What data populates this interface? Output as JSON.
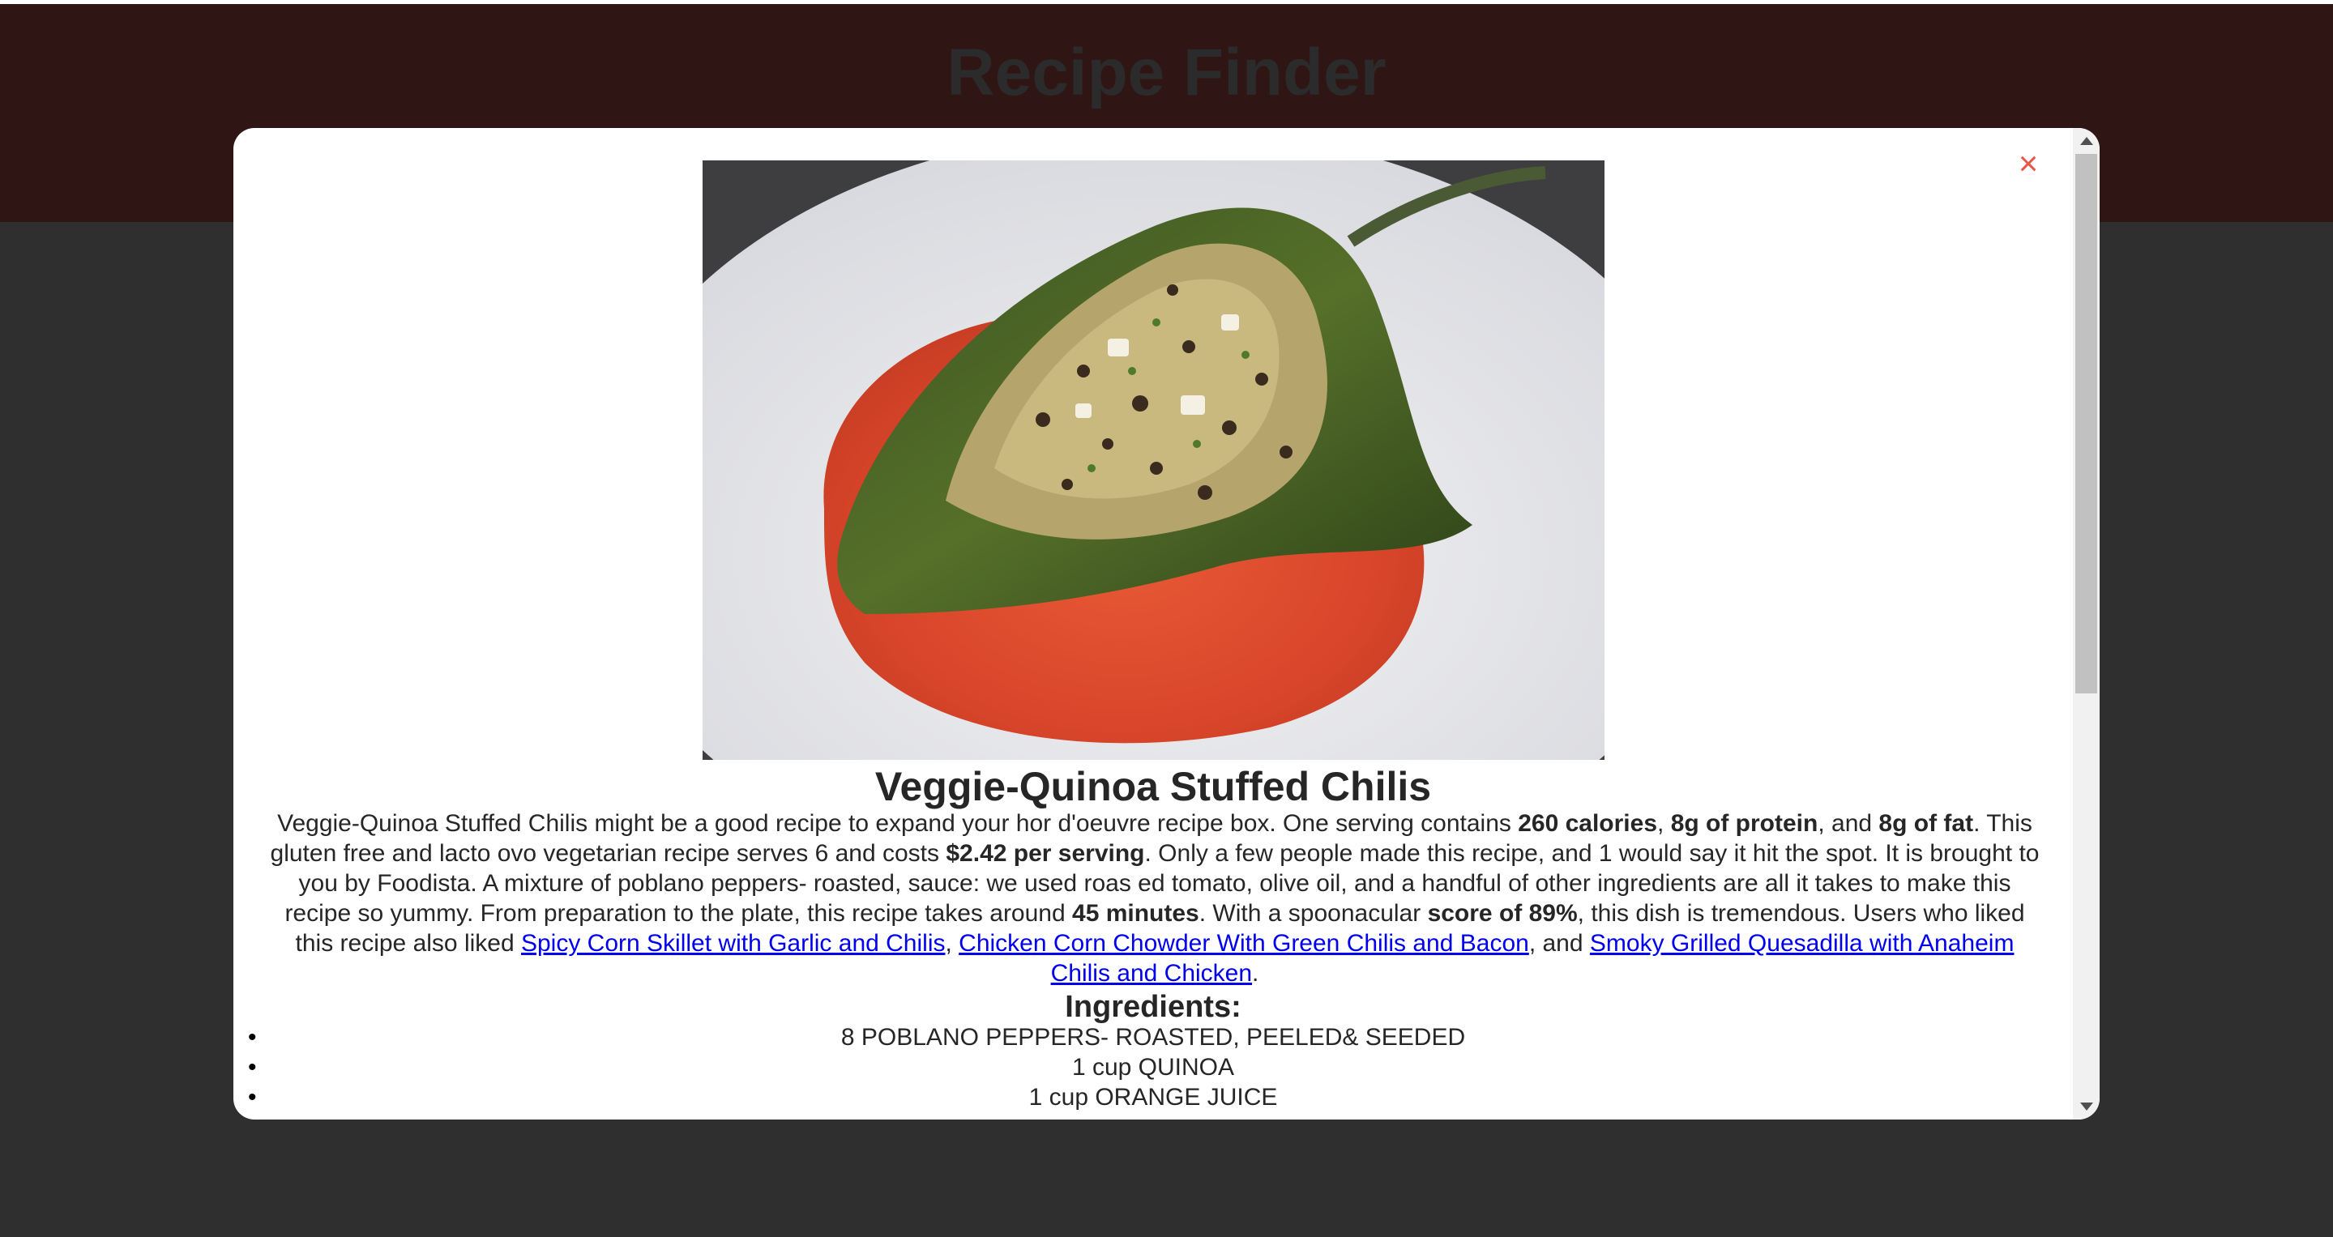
{
  "app": {
    "title": "Recipe Finder"
  },
  "modal": {
    "close_label": "×",
    "recipe_title": "Veggie-Quinoa Stuffed Chilis",
    "summary": {
      "t1": "Veggie-Quinoa Stuffed Chilis might be a good recipe to expand your hor d'oeuvre recipe box. One serving contains ",
      "calories": "260 calories",
      "t2": ", ",
      "protein": "8g of protein",
      "t3": ", and ",
      "fat": "8g of fat",
      "t4": ". This gluten free and lacto ovo vegetarian recipe serves 6 and costs ",
      "cost": "$2.42 per serving",
      "t5": ". Only a few people made this recipe, and 1 would say it hit the spot. It is brought to you by Foodista. A mixture of poblano peppers- roasted, sauce: we used roas ed tomato, olive oil, and a handful of other ingredients are all it takes to make this recipe so yummy. From preparation to the plate, this recipe takes around ",
      "time": "45 minutes",
      "t6": ". With a spoonacular ",
      "score": "score of 89%",
      "t7": ", this dish is tremendous. Users who liked this recipe also liked ",
      "link1": "Spicy Corn Skillet with Garlic and Chilis",
      "t8": ", ",
      "link2": "Chicken Corn Chowder With Green Chilis and Bacon",
      "t9": ", and ",
      "link3": "Smoky Grilled Quesadilla with Anaheim Chilis and Chicken",
      "t10": "."
    },
    "ingredients_heading": "Ingredients:",
    "ingredients": [
      "8 POBLANO PEPPERS- ROASTED, PEELED& SEEDED",
      "1 cup QUINOA",
      "1 cup ORANGE JUICE"
    ],
    "bullet": "•"
  }
}
